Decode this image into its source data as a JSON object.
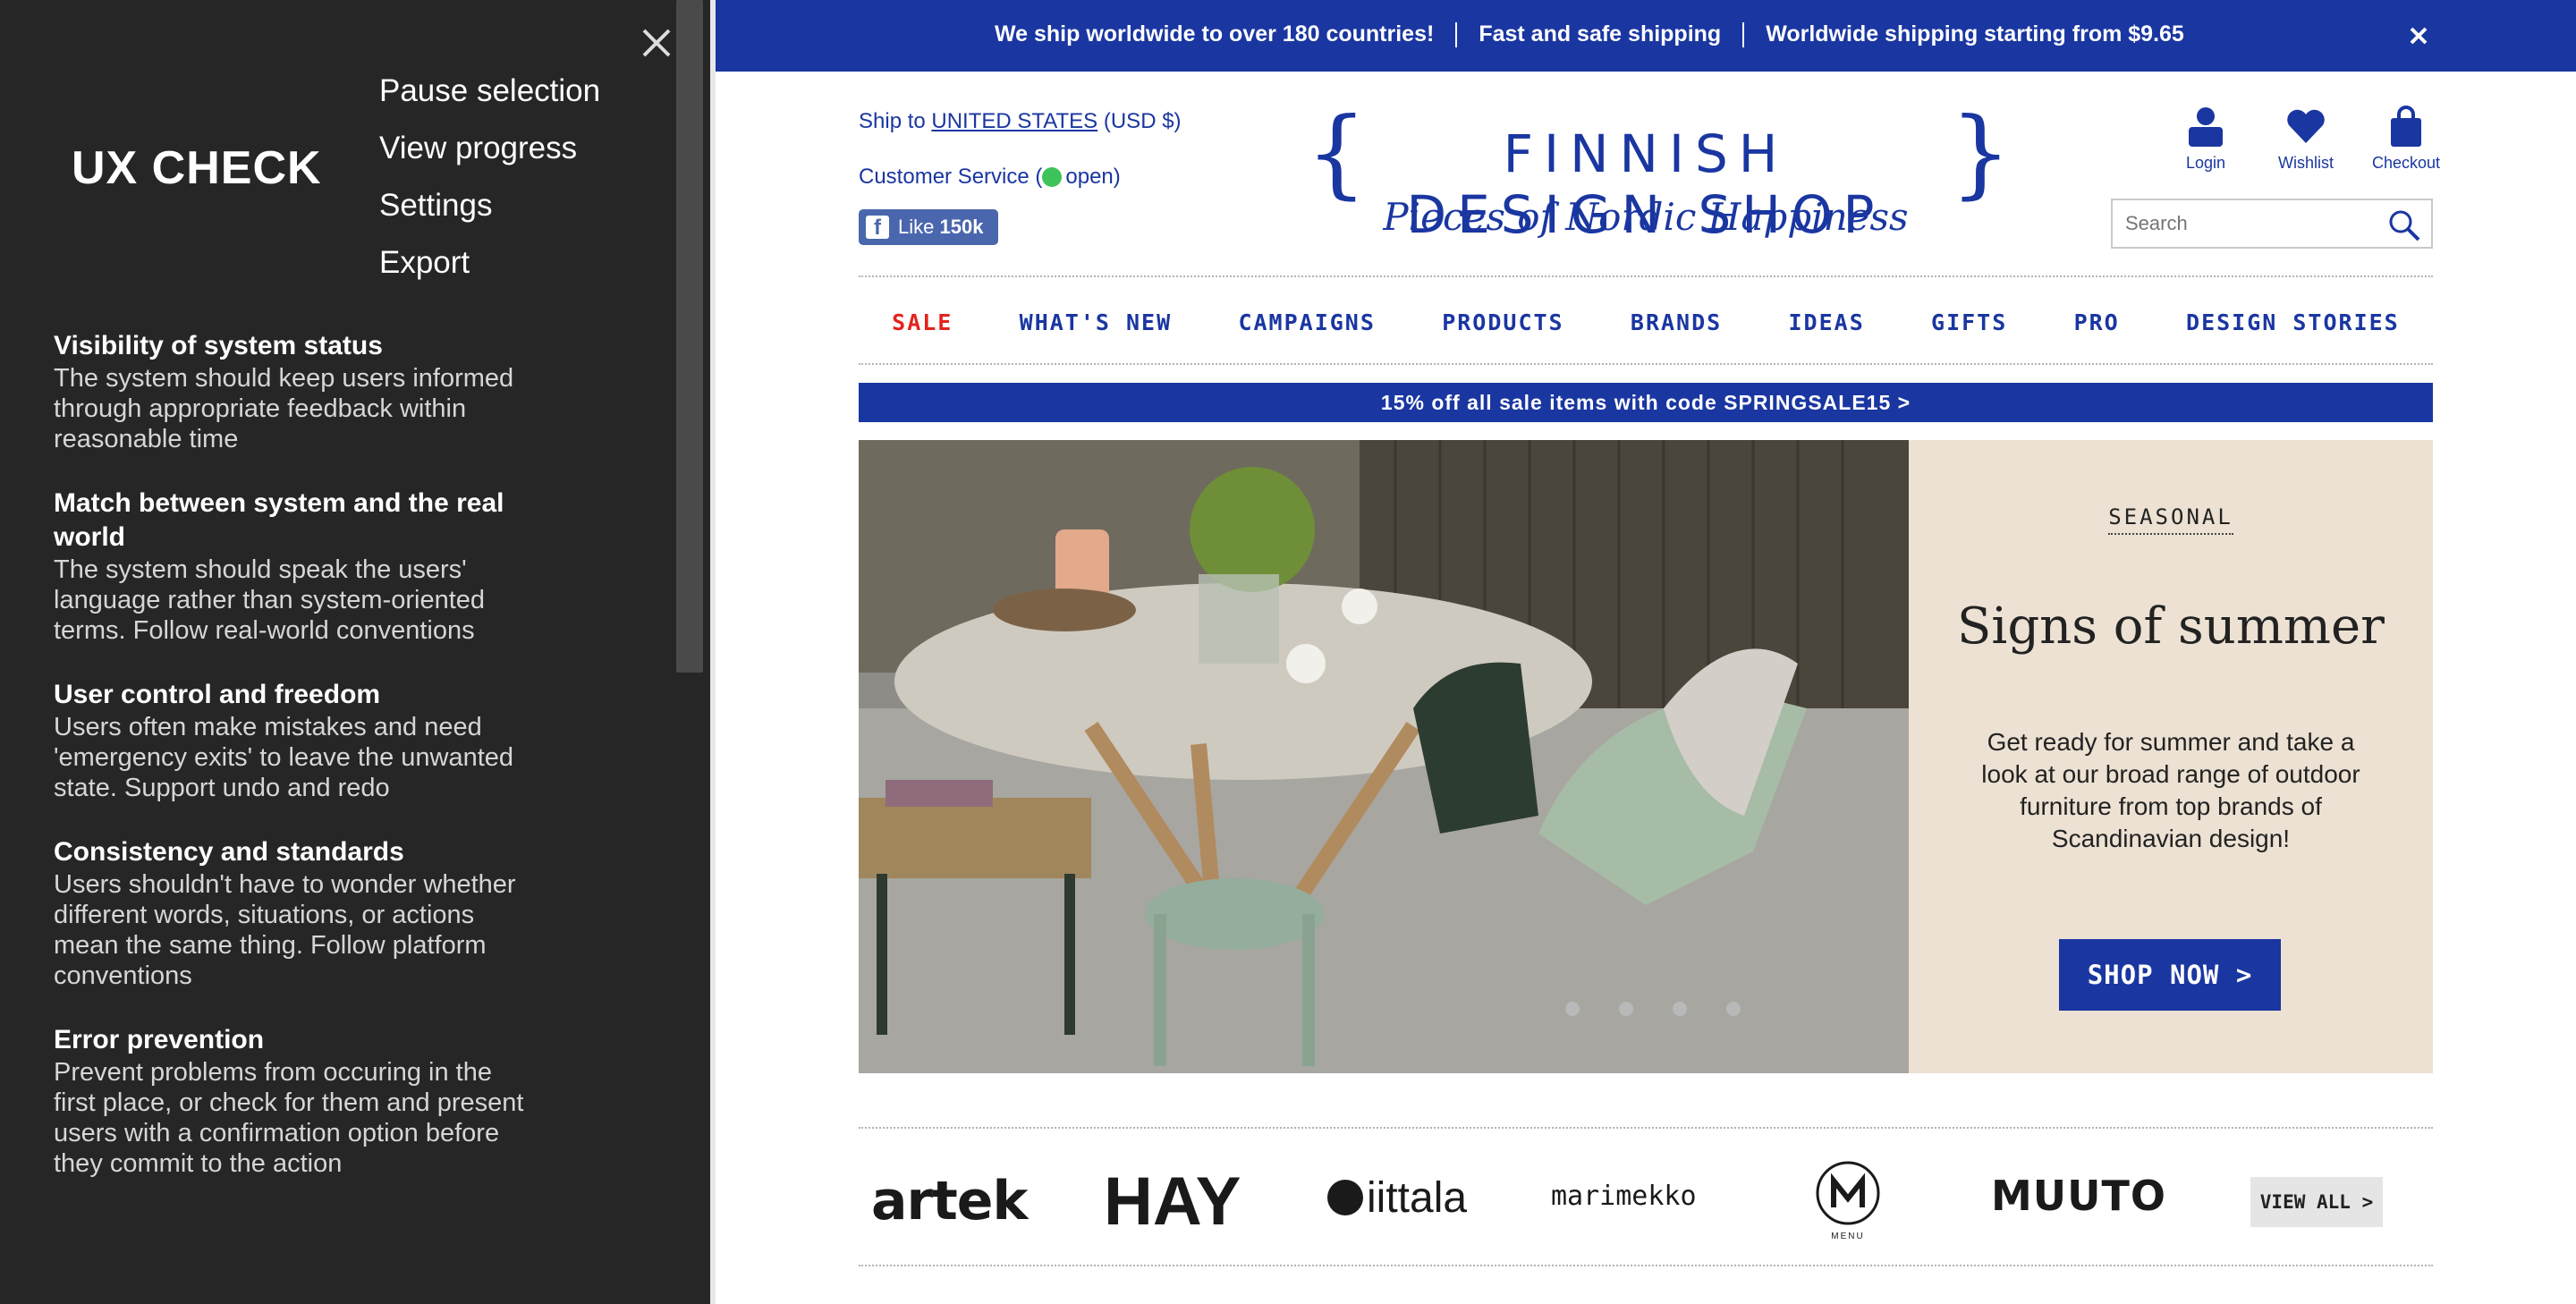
{
  "ux_panel": {
    "title": "UX CHECK",
    "menu": [
      "Pause selection",
      "View progress",
      "Settings",
      "Export"
    ],
    "heuristics": [
      {
        "title": "Visibility of system status",
        "desc": "The system should keep users informed through appropriate feedback within reasonable time"
      },
      {
        "title": "Match between system and the real world",
        "desc": "The system should speak the users' language rather than system-oriented terms. Follow real-world conventions"
      },
      {
        "title": "User control and freedom",
        "desc": "Users often make mistakes and need 'emergency exits' to leave the unwanted state. Support undo and redo"
      },
      {
        "title": "Consistency and standards",
        "desc": "Users shouldn't have to wonder whether different words, situations, or actions mean the same thing. Follow platform conventions"
      },
      {
        "title": "Error prevention",
        "desc": "Prevent problems from occuring in the first place, or check for them and present users with a confirmation option before they commit to the action"
      }
    ]
  },
  "topbar": {
    "messages": [
      "We ship worldwide to over 180 countries!",
      "Fast and safe shipping",
      "Worldwide shipping starting from $9.65"
    ]
  },
  "header": {
    "ship_to_label": "Ship to",
    "ship_to_country": "UNITED STATES",
    "currency": "(USD $)",
    "customer_service_label": "Customer Service (",
    "customer_service_status": "open)",
    "fb_like_label": "Like",
    "fb_like_count": "150k",
    "logo_name": "FINNISH DESIGN SHOP",
    "logo_tagline": "Pieces of Nordic Happiness",
    "login_label": "Login",
    "wishlist_label": "Wishlist",
    "checkout_label": "Checkout",
    "search_placeholder": "Search"
  },
  "nav": [
    "SALE",
    "WHAT'S NEW",
    "CAMPAIGNS",
    "PRODUCTS",
    "BRANDS",
    "IDEAS",
    "GIFTS",
    "PRO",
    "DESIGN STORIES"
  ],
  "promo": "15% off all sale items with code SPRINGSALE15 >",
  "hero": {
    "kicker": "SEASONAL",
    "title": "Signs of summer",
    "body": "Get ready for summer and take a look at our broad range of outdoor furniture from top brands of Scandinavian design!",
    "cta": "SHOP NOW >",
    "slide_count": 4
  },
  "brands": {
    "items": [
      "artek",
      "HAY",
      "iittala",
      "marimekko",
      "MENU",
      "MUUTO"
    ],
    "menu_sublabel": "MENU",
    "view_all": "VIEW ALL >"
  },
  "colors": {
    "brand_blue": "#1a36a1",
    "sale_red": "#e3231c",
    "panel_dark": "#262626",
    "hero_beige": "#ece1d2"
  }
}
